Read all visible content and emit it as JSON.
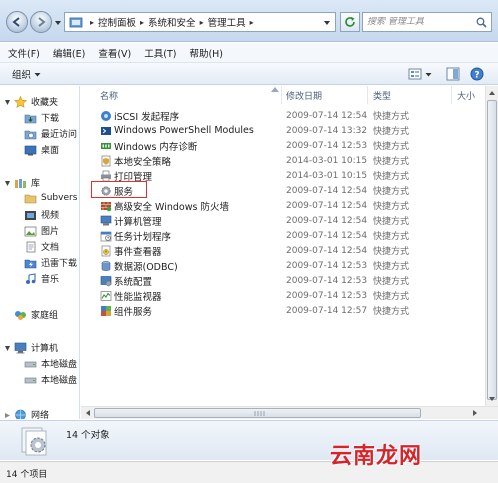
{
  "address_bar": {
    "breadcrumbs": [
      "控制面板",
      "系统和安全",
      "管理工具"
    ],
    "search_placeholder": "搜索 管理工具"
  },
  "menubar": {
    "items": [
      "文件(F)",
      "编辑(E)",
      "查看(V)",
      "工具(T)",
      "帮助(H)"
    ]
  },
  "toolbar": {
    "organize_label": "组织"
  },
  "nav_pane": {
    "favorites": {
      "label": "收藏夹",
      "items": [
        "下载",
        "最近访问",
        "桌面"
      ]
    },
    "libraries": {
      "label": "库",
      "items": [
        "Subvers",
        "视频",
        "图片",
        "文档",
        "迅雷下载",
        "音乐"
      ]
    },
    "homegroup": {
      "label": "家庭组"
    },
    "computer": {
      "label": "计算机",
      "items": [
        "本地磁盘",
        "本地磁盘"
      ]
    },
    "network": {
      "label": "网络"
    }
  },
  "columns": {
    "name": "名称",
    "date": "修改日期",
    "type": "类型",
    "size": "大小"
  },
  "files": [
    {
      "name": "iSCSI 发起程序",
      "date": "2009-07-14 12:54",
      "type": "快捷方式"
    },
    {
      "name": "Windows PowerShell Modules",
      "date": "2009-07-14 13:32",
      "type": "快捷方式"
    },
    {
      "name": "Windows 内存诊断",
      "date": "2009-07-14 12:53",
      "type": "快捷方式"
    },
    {
      "name": "本地安全策略",
      "date": "2014-03-01 10:15",
      "type": "快捷方式"
    },
    {
      "name": "打印管理",
      "date": "2014-03-01 10:15",
      "type": "快捷方式"
    },
    {
      "name": "服务",
      "date": "2009-07-14 12:54",
      "type": "快捷方式"
    },
    {
      "name": "高级安全 Windows 防火墙",
      "date": "2009-07-14 12:54",
      "type": "快捷方式"
    },
    {
      "name": "计算机管理",
      "date": "2009-07-14 12:54",
      "type": "快捷方式"
    },
    {
      "name": "任务计划程序",
      "date": "2009-07-14 12:54",
      "type": "快捷方式"
    },
    {
      "name": "事件查看器",
      "date": "2009-07-14 12:54",
      "type": "快捷方式"
    },
    {
      "name": "数据源(ODBC)",
      "date": "2009-07-14 12:53",
      "type": "快捷方式"
    },
    {
      "name": "系统配置",
      "date": "2009-07-14 12:53",
      "type": "快捷方式"
    },
    {
      "name": "性能监视器",
      "date": "2009-07-14 12:53",
      "type": "快捷方式"
    },
    {
      "name": "组件服务",
      "date": "2009-07-14 12:57",
      "type": "快捷方式"
    }
  ],
  "details_pane": {
    "count": "14 个对象"
  },
  "status_bar": {
    "text": "14 个项目"
  },
  "watermark": "云南龙网",
  "colors": {
    "highlight": "#e0302b",
    "watermark": "#d6242b"
  }
}
